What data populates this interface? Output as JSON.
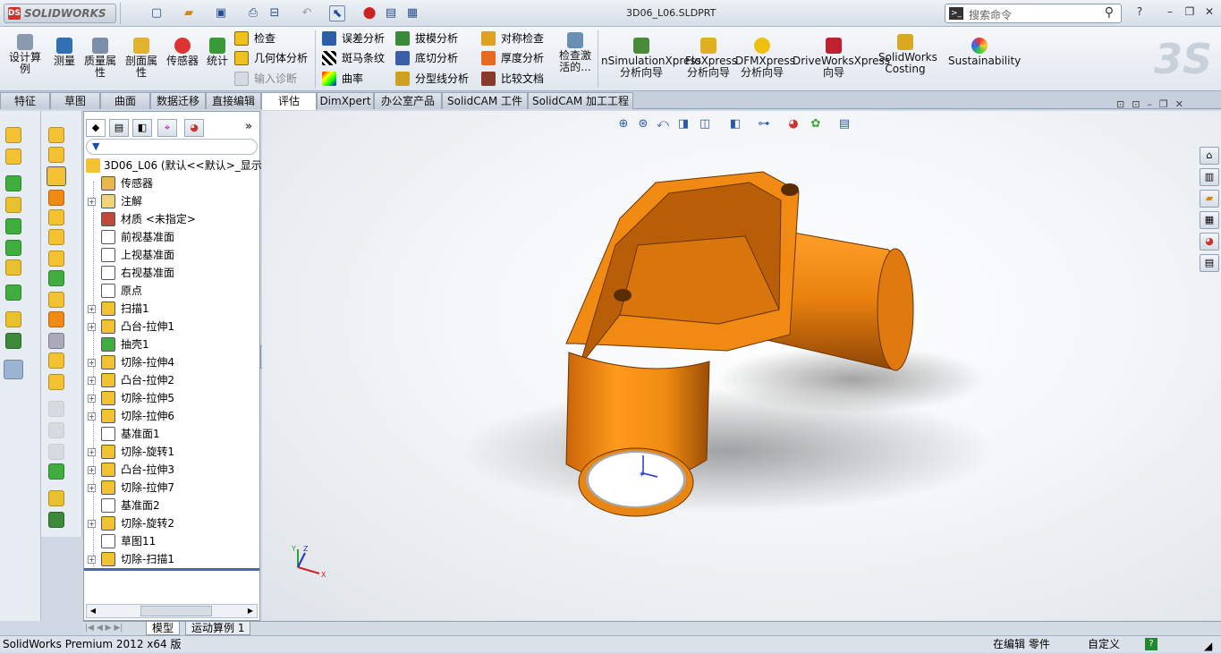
{
  "app": {
    "logo_text": "SOLIDWORKS",
    "logo_mark": "DS",
    "file_name": "3D06_L06.SLDPRT"
  },
  "search": {
    "placeholder": "搜索命令",
    "help": "?"
  },
  "ribbon": {
    "design_study": "设计算例",
    "measure": "测量",
    "mass_props": "质量属性",
    "section_props": "剖面属性",
    "sensor": "传感器",
    "stats": "统计",
    "check": "检查",
    "geometry_analysis": "几何体分析",
    "import_diagnostics": "输入诊断",
    "deviation_analysis": "误差分析",
    "zebra": "斑马条纹",
    "curvature": "曲率",
    "draft_analysis": "拔模分析",
    "undercut": "底切分析",
    "parting_line": "分型线分析",
    "symmetry_check": "对称检查",
    "thickness": "厚度分析",
    "compare": "比较文档",
    "check_active": "检查激活的...",
    "simxpress": "nSimulationXpress分析向导",
    "floxpress": "FloXpress分析向导",
    "dfmxpress": "DFMXpress分析向导",
    "driveworks": "DriveWorksXpress向导",
    "costing": "SolidWorks Costing",
    "sustainability": "Sustainability"
  },
  "tabs": [
    "特征",
    "草图",
    "曲面",
    "数据迁移",
    "直接编辑",
    "评估",
    "DimXpert",
    "办公室产品",
    "SolidCAM 工件",
    "SolidCAM 加工工程"
  ],
  "active_tab": "评估",
  "tree": {
    "root": "3D06_L06  (默认<<默认>_显示",
    "nodes": [
      {
        "label": "传感器",
        "expandable": false,
        "icon": "sensor-icon",
        "color": "#e8b84a"
      },
      {
        "label": "注解",
        "expandable": true,
        "icon": "annotation-icon",
        "color": "#f3d37a"
      },
      {
        "label": "材质 <未指定>",
        "expandable": false,
        "icon": "material-icon",
        "color": "#c04a3a"
      },
      {
        "label": "前视基准面",
        "expandable": false,
        "icon": "plane-icon",
        "color": "#ffffff"
      },
      {
        "label": "上视基准面",
        "expandable": false,
        "icon": "plane-icon",
        "color": "#ffffff"
      },
      {
        "label": "右视基准面",
        "expandable": false,
        "icon": "plane-icon",
        "color": "#ffffff"
      },
      {
        "label": "原点",
        "expandable": false,
        "icon": "origin-icon",
        "color": "#ffffff"
      },
      {
        "label": "扫描1",
        "expandable": true,
        "icon": "sweep-icon",
        "color": "#f2c232"
      },
      {
        "label": "凸台-拉伸1",
        "expandable": true,
        "icon": "boss-extrude-icon",
        "color": "#f2c232"
      },
      {
        "label": "抽壳1",
        "expandable": false,
        "icon": "shell-icon",
        "color": "#3fae3f"
      },
      {
        "label": "切除-拉伸4",
        "expandable": true,
        "icon": "cut-extrude-icon",
        "color": "#f2c232"
      },
      {
        "label": "凸台-拉伸2",
        "expandable": true,
        "icon": "boss-extrude-icon",
        "color": "#f2c232"
      },
      {
        "label": "切除-拉伸5",
        "expandable": true,
        "icon": "cut-extrude-icon",
        "color": "#f2c232"
      },
      {
        "label": "切除-拉伸6",
        "expandable": true,
        "icon": "cut-extrude-icon",
        "color": "#f2c232"
      },
      {
        "label": "基准面1",
        "expandable": false,
        "icon": "plane-icon",
        "color": "#ffffff"
      },
      {
        "label": "切除-旋转1",
        "expandable": true,
        "icon": "cut-revolve-icon",
        "color": "#f2c232"
      },
      {
        "label": "凸台-拉伸3",
        "expandable": true,
        "icon": "boss-extrude-icon",
        "color": "#f2c232"
      },
      {
        "label": "切除-拉伸7",
        "expandable": true,
        "icon": "cut-extrude-icon",
        "color": "#f2c232"
      },
      {
        "label": "基准面2",
        "expandable": false,
        "icon": "plane-icon",
        "color": "#ffffff"
      },
      {
        "label": "切除-旋转2",
        "expandable": true,
        "icon": "cut-revolve-icon",
        "color": "#f2c232"
      },
      {
        "label": "草图11",
        "expandable": false,
        "icon": "sketch-icon",
        "color": "#ffffff"
      },
      {
        "label": "切除-扫描1",
        "expandable": true,
        "icon": "cut-sweep-icon",
        "color": "#f2c232"
      }
    ]
  },
  "bottom_tabs": [
    "模型",
    "运动算例 1"
  ],
  "status": {
    "left": "SolidWorks Premium 2012 x64 版",
    "mode": "在编辑 零件",
    "units": "自定义"
  },
  "triad": {
    "x": "X",
    "y": "Y",
    "z": "Z"
  },
  "colors": {
    "part": "#f08a12",
    "part_dark": "#a55607"
  }
}
